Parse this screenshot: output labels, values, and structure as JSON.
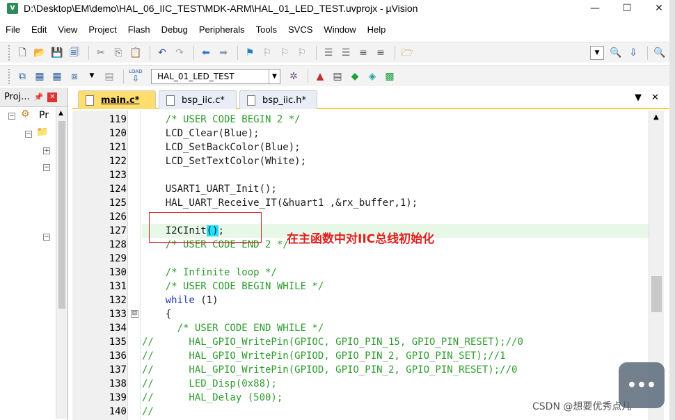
{
  "window": {
    "title": "D:\\Desktop\\EM\\demo\\HAL_06_IIC_TEST\\MDK-ARM\\HAL_01_LED_TEST.uvprojx - µVision",
    "app_icon": "uvision-icon",
    "buttons": [
      "—",
      "☐",
      "✕"
    ]
  },
  "menu": [
    "File",
    "Edit",
    "View",
    "Project",
    "Flash",
    "Debug",
    "Peripherals",
    "Tools",
    "SVCS",
    "Window",
    "Help"
  ],
  "toolbar2": {
    "target": "HAL_01_LED_TEST",
    "load_label": "LOAD"
  },
  "project_panel": {
    "title": "Proj...",
    "root_label": "Pr",
    "pin": "📌",
    "close": "✕"
  },
  "tabs": [
    {
      "label": "main.c*",
      "active": true
    },
    {
      "label": "bsp_iic.c*",
      "active": false
    },
    {
      "label": "bsp_iic.h*",
      "active": false
    }
  ],
  "tab_controls": {
    "dropdown": "▼",
    "close": "✕"
  },
  "code": {
    "lines": [
      {
        "no": "119",
        "text": "    /* USER CODE BEGIN 2 */",
        "kind": "comment"
      },
      {
        "no": "120",
        "text": "    LCD_Clear(Blue);",
        "kind": "plain"
      },
      {
        "no": "121",
        "text": "    LCD_SetBackColor(Blue);",
        "kind": "plain"
      },
      {
        "no": "122",
        "text": "    LCD_SetTextColor(White);",
        "kind": "plain"
      },
      {
        "no": "123",
        "text": "",
        "kind": "plain"
      },
      {
        "no": "124",
        "text": "    USART1_UART_Init();",
        "kind": "plain"
      },
      {
        "no": "125",
        "text": "    HAL_UART_Receive_IT(&huart1 ,&rx_buffer,1);",
        "kind": "plain"
      },
      {
        "no": "126",
        "text": "",
        "kind": "plain"
      },
      {
        "no": "127",
        "text": "    I2CInit",
        "kind": "cursor",
        "bracket": "()",
        "tail": ";"
      },
      {
        "no": "128",
        "text": "    /* USER CODE END 2 */",
        "kind": "comment"
      },
      {
        "no": "129",
        "text": "",
        "kind": "plain"
      },
      {
        "no": "130",
        "text": "    /* Infinite loop */",
        "kind": "comment"
      },
      {
        "no": "131",
        "text": "    /* USER CODE BEGIN WHILE */",
        "kind": "comment"
      },
      {
        "no": "132",
        "text": "    while",
        "kind": "keyword",
        "tail": " (1)"
      },
      {
        "no": "133",
        "text": "    {",
        "kind": "plain"
      },
      {
        "no": "134",
        "text": "      /* USER CODE END WHILE */",
        "kind": "comment"
      },
      {
        "no": "135",
        "text": "//      HAL_GPIO_WritePin(GPIOC, GPIO_PIN_15, GPIO_PIN_RESET);//0",
        "kind": "comment"
      },
      {
        "no": "136",
        "text": "//      HAL_GPIO_WritePin(GPIOD, GPIO_PIN_2, GPIO_PIN_SET);//1",
        "kind": "comment"
      },
      {
        "no": "137",
        "text": "//      HAL_GPIO_WritePin(GPIOD, GPIO_PIN_2, GPIO_PIN_RESET);//0",
        "kind": "comment"
      },
      {
        "no": "138",
        "text": "//      LED_Disp(0x88);",
        "kind": "comment"
      },
      {
        "no": "139",
        "text": "//      HAL_Delay (500);",
        "kind": "comment"
      },
      {
        "no": "140",
        "text": "//",
        "kind": "comment"
      }
    ],
    "fold_markers": [
      {
        "line_index": 14,
        "symbol": "⊟"
      }
    ]
  },
  "annotation": "在主函数中对IIC总线初始化",
  "watermark": "CSDN @想要优秀点儿",
  "colors": {
    "comment": "#2e9b2e",
    "keyword": "#2030c0",
    "active_tab": "#ffde6e",
    "highlight_row": "#e8f8e8",
    "annotation": "#e02020"
  }
}
